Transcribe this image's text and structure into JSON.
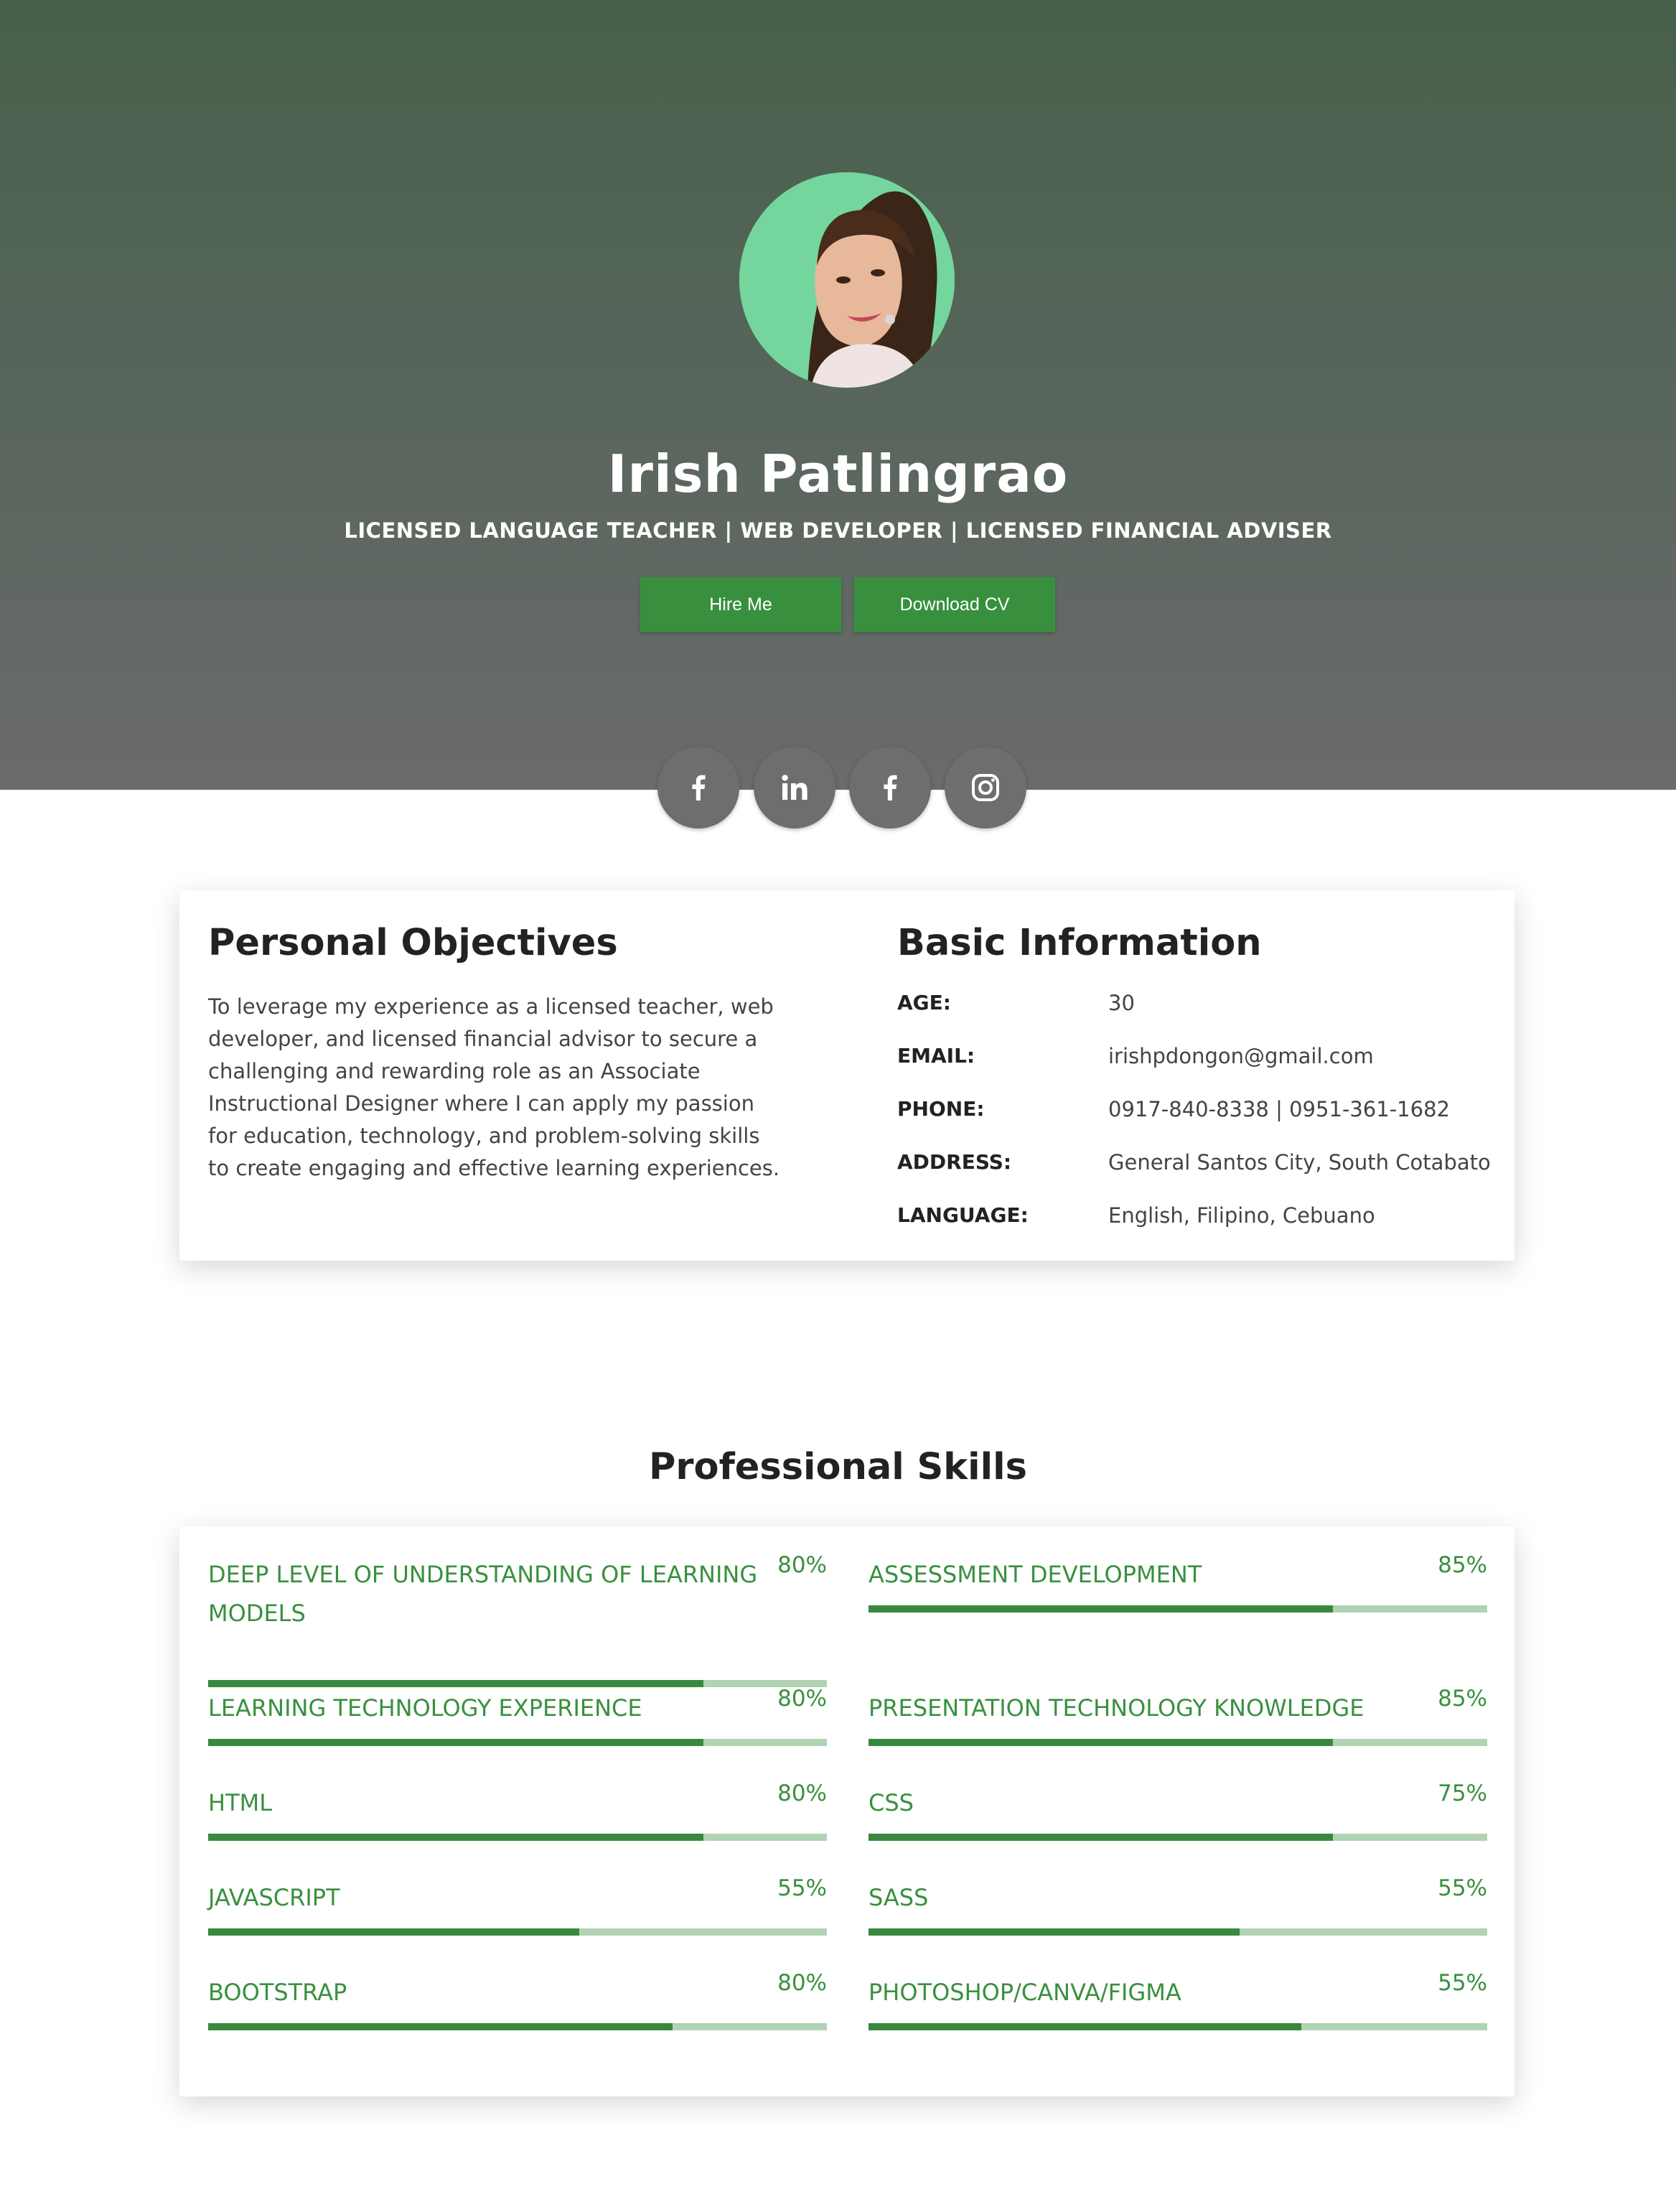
{
  "profile": {
    "name": "Irish Patlingrao",
    "tagline": "LICENSED LANGUAGE TEACHER | WEB DEVELOPER | LICENSED FINANCIAL ADVISER",
    "hire_label": "Hire Me",
    "cv_label": "Download CV"
  },
  "social": [
    {
      "icon": "facebook-icon"
    },
    {
      "icon": "linkedin-icon"
    },
    {
      "icon": "facebook-icon"
    },
    {
      "icon": "instagram-icon"
    }
  ],
  "objectives": {
    "title": "Personal Objectives",
    "text": "To leverage my experience as a licensed teacher, web developer, and licensed financial advisor to secure a challenging and rewarding role as an Associate Instructional Designer where I can apply my passion for education, technology, and problem-solving skills to create engaging and effective learning experiences."
  },
  "basic_info": {
    "title": "Basic Information",
    "rows": [
      {
        "label": "AGE:",
        "value": "30"
      },
      {
        "label": "EMAIL:",
        "value": "irishpdongon@gmail.com"
      },
      {
        "label": "PHONE:",
        "value": "0917-840-8338 | 0951-361-1682"
      },
      {
        "label": "ADDRESS:",
        "value": "General Santos City, South Cotabato"
      },
      {
        "label": "LANGUAGE:",
        "value": "English, Filipino, Cebuano"
      }
    ]
  },
  "skills": {
    "title": "Professional Skills",
    "left": [
      {
        "name": "DEEP LEVEL OF UNDERSTANDING OF LEARNING MODELS",
        "pct": "80%",
        "level": 0.8
      },
      {
        "name": "LEARNING TECHNOLOGY EXPERIENCE",
        "pct": "80%",
        "level": 0.8
      },
      {
        "name": "HTML",
        "pct": "80%",
        "level": 0.8
      },
      {
        "name": "JAVASCRIPT",
        "pct": "55%",
        "level": 0.6
      },
      {
        "name": "BOOTSTRAP",
        "pct": "80%",
        "level": 0.75
      }
    ],
    "right": [
      {
        "name": "ASSESSMENT DEVELOPMENT",
        "pct": "85%",
        "level": 0.75
      },
      {
        "name": "PRESENTATION TECHNOLOGY KNOWLEDGE",
        "pct": "85%",
        "level": 0.75
      },
      {
        "name": "CSS",
        "pct": "75%",
        "level": 0.75
      },
      {
        "name": "SASS",
        "pct": "55%",
        "level": 0.6
      },
      {
        "name": "PHOTOSHOP/CANVA/FIGMA",
        "pct": "55%",
        "level": 0.7
      }
    ]
  },
  "colors": {
    "accent": "#38903f",
    "bar_track": "#b1d2b3",
    "hero_top": "#46604a",
    "hero_bottom": "#6a6b6b"
  }
}
